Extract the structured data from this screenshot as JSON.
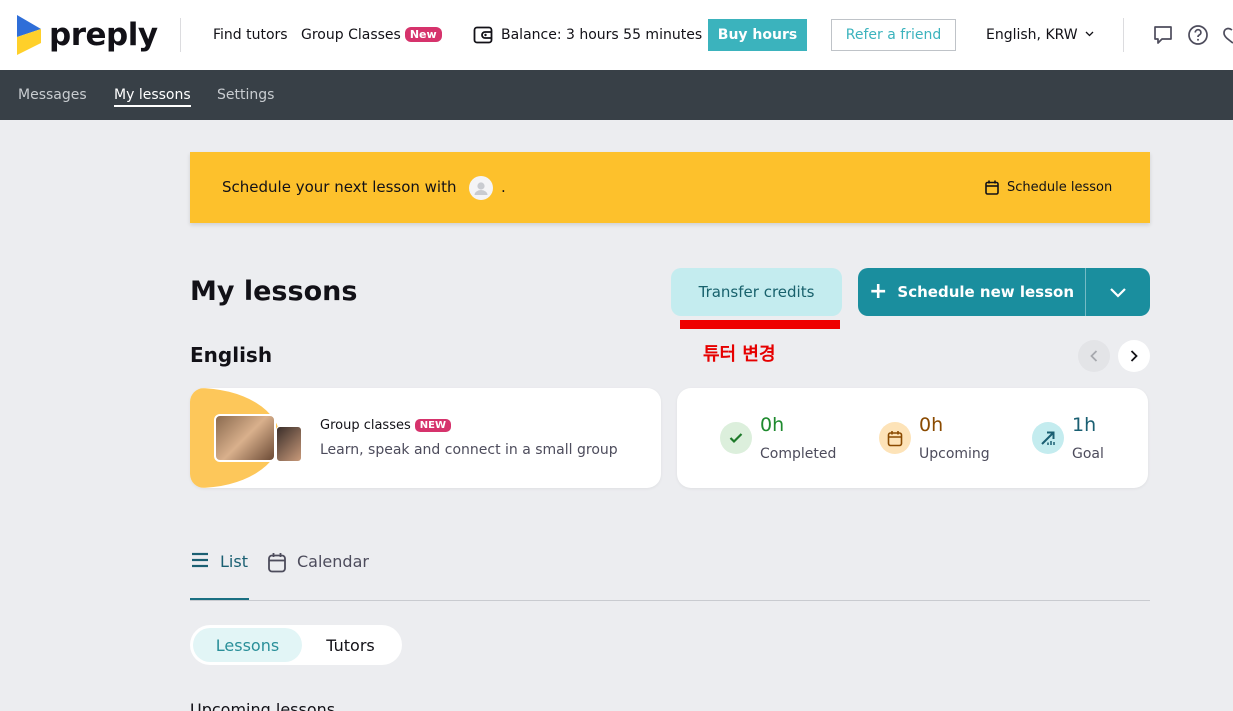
{
  "topbar": {
    "logo_text": "preply",
    "find_tutors": "Find tutors",
    "group_classes": "Group Classes",
    "group_classes_badge": "New",
    "balance": "Balance: 3 hours 55 minutes",
    "buy_hours": "Buy hours",
    "refer_friend": "Refer a friend",
    "language_currency": "English, KRW"
  },
  "subnav": {
    "items": [
      {
        "label": "Messages"
      },
      {
        "label": "My lessons"
      },
      {
        "label": "Settings"
      }
    ],
    "active": "My lessons"
  },
  "banner": {
    "text": "Schedule your next lesson with",
    "trailing": ".",
    "schedule_link": "Schedule lesson"
  },
  "header": {
    "title": "My lessons",
    "transfer_credits": "Transfer credits",
    "schedule_new_lesson": "Schedule new lesson",
    "annotation": "튜터 변경"
  },
  "section": {
    "language": "English"
  },
  "group_card": {
    "title": "Group classes",
    "badge": "NEW",
    "description": "Learn, speak and connect in a small group"
  },
  "stats": [
    {
      "value": "0h",
      "label": "Completed",
      "color": "#1e8a2e"
    },
    {
      "value": "0h",
      "label": "Upcoming",
      "color": "#8a4a00"
    },
    {
      "value": "1h",
      "label": "Goal",
      "color": "#1a5f72"
    }
  ],
  "view_tabs": {
    "list": "List",
    "calendar": "Calendar"
  },
  "segment": {
    "lessons": "Lessons",
    "tutors": "Tutors"
  },
  "upcoming_heading": "Upcoming lessons",
  "colors": {
    "accent": "#1a8e9e",
    "banner": "#fdc12c",
    "nav": "#384047"
  }
}
